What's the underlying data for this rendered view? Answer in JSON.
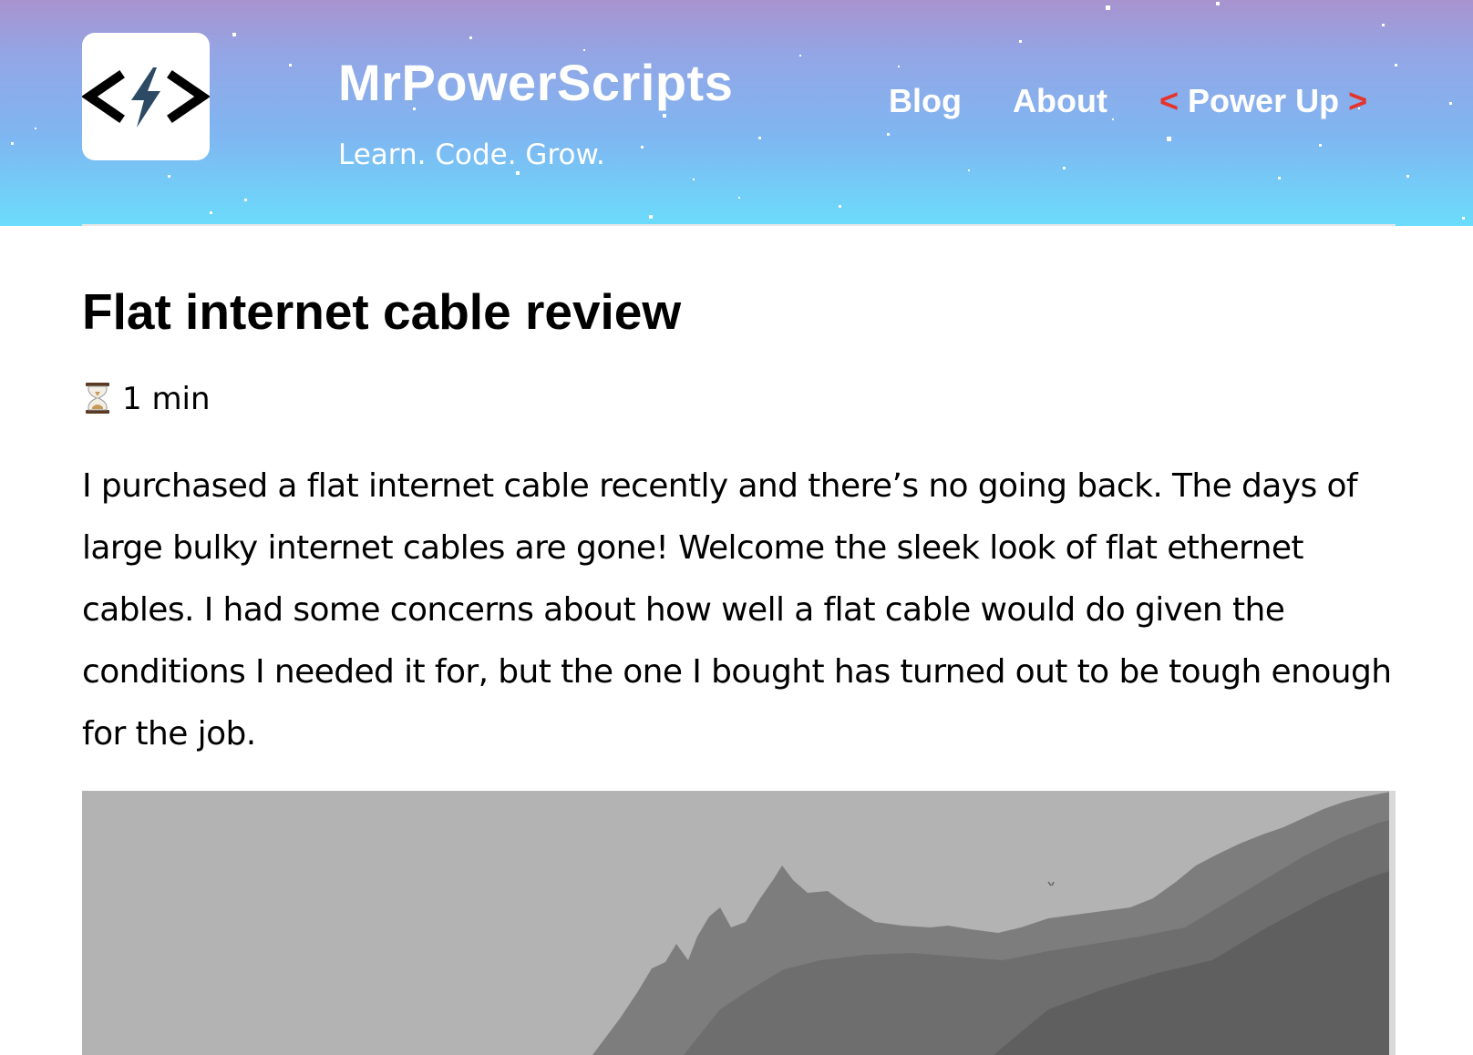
{
  "site": {
    "title": "MrPowerScripts",
    "tagline": "Learn. Code. Grow.",
    "logo_icon": "code-bolt-icon"
  },
  "nav": {
    "blog": "Blog",
    "about": "About",
    "power_up_open": "<",
    "power_up_label": "Power Up",
    "power_up_close": ">"
  },
  "colors": {
    "header_top": "#a893ce",
    "header_bottom": "#6bdcfb",
    "accent": "#e5342c",
    "logo_bolt": "#2c4a63"
  },
  "article": {
    "title": "Flat internet cable review",
    "read_time": "1 min",
    "read_time_icon": "hourglass-icon",
    "body": "I purchased a flat internet cable recently and there’s no going back. The days of large bulky internet cables are gone! Welcome the sleek look of flat ethernet cables. I had some concerns about how well a flat cable would do given the conditions I needed it for, but the one I bought has turned out to be tough enough for the job.",
    "hero_image": "grayscale-mountain-landscape"
  }
}
